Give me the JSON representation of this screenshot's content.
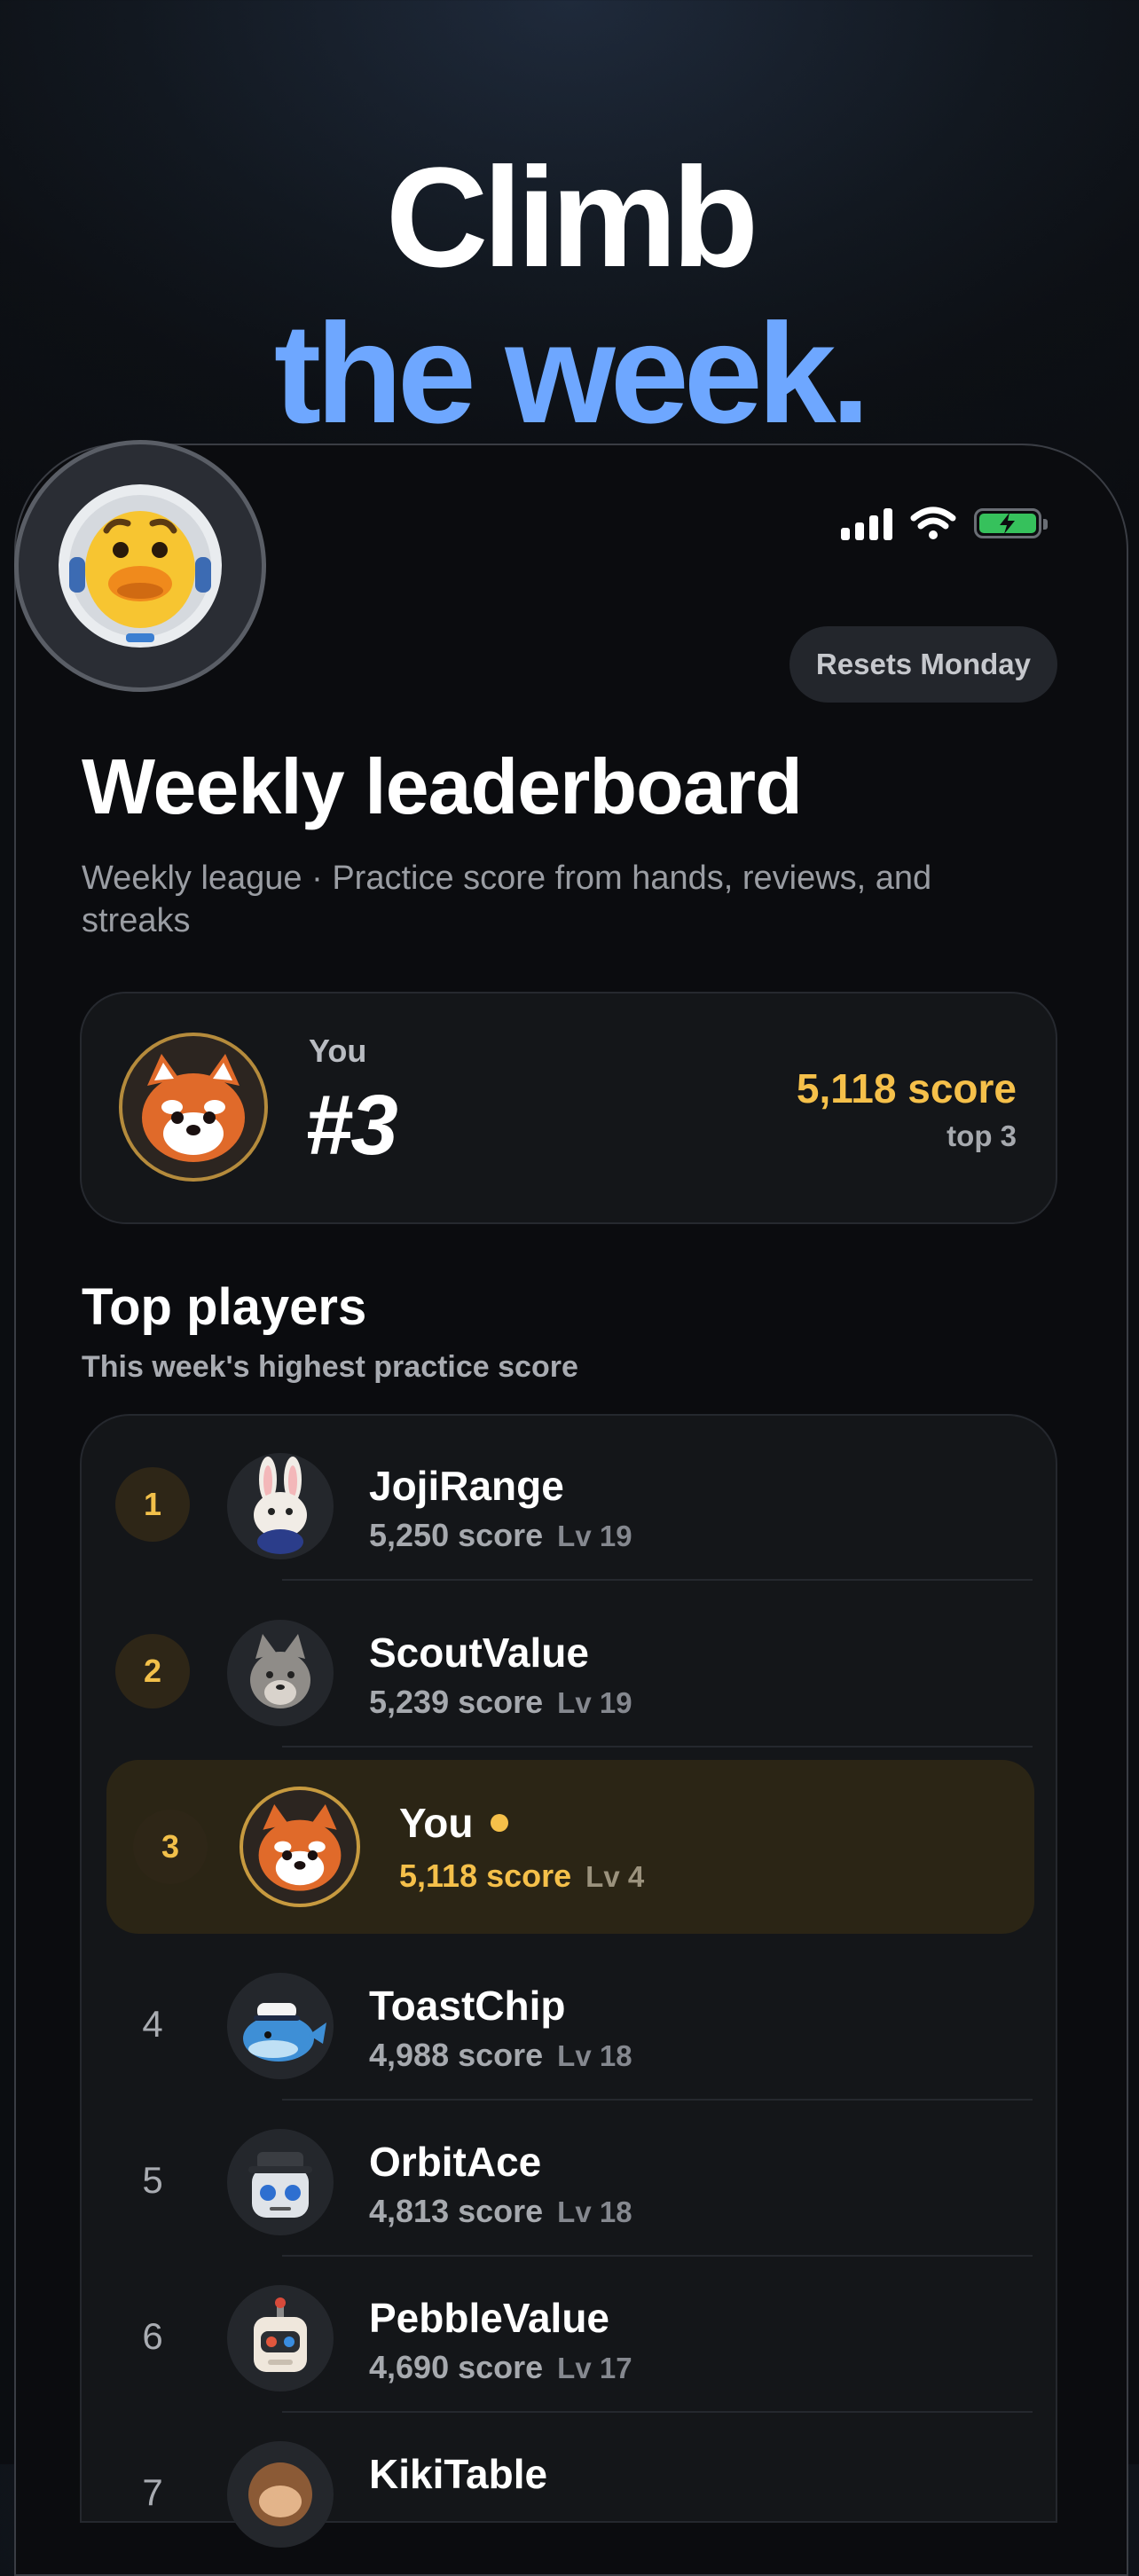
{
  "hero": {
    "line1": "Climb",
    "line2": "the week."
  },
  "header": {
    "reset_label": "Resets Monday"
  },
  "page": {
    "title": "Weekly leaderboard",
    "subtitle": "Weekly league · Practice score from hands, reviews, and streaks"
  },
  "you_card": {
    "label": "You",
    "rank": "#3",
    "score": "5,118 score",
    "sub": "top 3"
  },
  "top_players": {
    "title": "Top players",
    "subtitle": "This week's highest practice score",
    "rows": [
      {
        "rank": "1",
        "name": "JojiRange",
        "score": "5,250 score",
        "level": "Lv 19",
        "avatar_icon": "bunny-avatar-icon"
      },
      {
        "rank": "2",
        "name": "ScoutValue",
        "score": "5,239 score",
        "level": "Lv 19",
        "avatar_icon": "wolf-avatar-icon"
      },
      {
        "rank": "3",
        "name": "You",
        "score": "5,118 score",
        "level": "Lv 4",
        "avatar_icon": "red-panda-avatar-icon"
      },
      {
        "rank": "4",
        "name": "ToastChip",
        "score": "4,988 score",
        "level": "Lv 18",
        "avatar_icon": "whale-avatar-icon"
      },
      {
        "rank": "5",
        "name": "OrbitAce",
        "score": "4,813 score",
        "level": "Lv 18",
        "avatar_icon": "robot-hat-avatar-icon"
      },
      {
        "rank": "6",
        "name": "PebbleValue",
        "score": "4,690 score",
        "level": "Lv 17",
        "avatar_icon": "robot-avatar-icon"
      },
      {
        "rank": "7",
        "name": "KikiTable",
        "score": "",
        "level": "",
        "avatar_icon": "monkey-avatar-icon"
      }
    ]
  },
  "colors": {
    "accent_blue": "#6ea7ff",
    "gold": "#f5c04a",
    "battery_green": "#36c15c"
  }
}
